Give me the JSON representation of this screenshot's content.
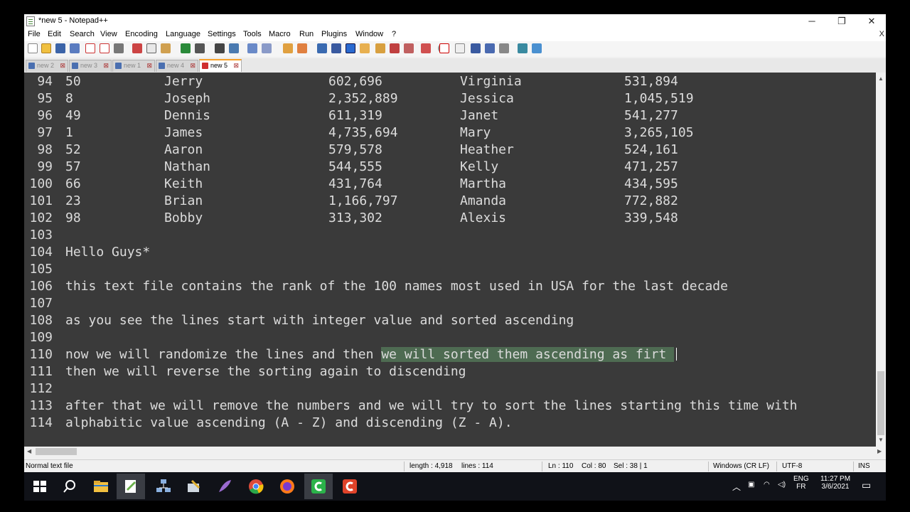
{
  "window": {
    "title": "*new 5 - Notepad++",
    "minimize": "─",
    "maximize": "❐",
    "close": "✕"
  },
  "menu": [
    "File",
    "Edit",
    "Search",
    "View",
    "Encoding",
    "Language",
    "Settings",
    "Tools",
    "Macro",
    "Run",
    "Plugins",
    "Window",
    "?"
  ],
  "menu_close": "X",
  "tabs": [
    {
      "label": "new 2",
      "active": false
    },
    {
      "label": "new 3",
      "active": false
    },
    {
      "label": "new 1",
      "active": false
    },
    {
      "label": "new 4",
      "active": false
    },
    {
      "label": "new 5",
      "active": true
    }
  ],
  "table_lines": [
    {
      "n": "94",
      "rank": "50",
      "male": "Jerry",
      "mcount": "602,696",
      "female": "Virginia",
      "fcount": "531,894"
    },
    {
      "n": "95",
      "rank": "8",
      "male": "Joseph",
      "mcount": "2,352,889",
      "female": "Jessica",
      "fcount": "1,045,519"
    },
    {
      "n": "96",
      "rank": "49",
      "male": "Dennis",
      "mcount": "611,319",
      "female": "Janet",
      "fcount": "541,277"
    },
    {
      "n": "97",
      "rank": "1",
      "male": "James",
      "mcount": "4,735,694",
      "female": "Mary",
      "fcount": "3,265,105"
    },
    {
      "n": "98",
      "rank": "52",
      "male": "Aaron",
      "mcount": "579,578",
      "female": "Heather",
      "fcount": "524,161"
    },
    {
      "n": "99",
      "rank": "57",
      "male": "Nathan",
      "mcount": "544,555",
      "female": "Kelly",
      "fcount": "471,257"
    },
    {
      "n": "100",
      "rank": "66",
      "male": "Keith",
      "mcount": "431,764",
      "female": "Martha",
      "fcount": "434,595"
    },
    {
      "n": "101",
      "rank": "23",
      "male": "Brian",
      "mcount": "1,166,797",
      "female": "Amanda",
      "fcount": "772,882"
    },
    {
      "n": "102",
      "rank": "98",
      "male": "Bobby",
      "mcount": "313,302",
      "female": "Alexis",
      "fcount": "339,548"
    }
  ],
  "text_lines": [
    {
      "n": "103",
      "text": ""
    },
    {
      "n": "104",
      "text": "Hello Guys*"
    },
    {
      "n": "105",
      "text": ""
    },
    {
      "n": "106",
      "text": "this text file contains the rank of the 100 names most used in USA for the last decade"
    },
    {
      "n": "107",
      "text": ""
    },
    {
      "n": "108",
      "text": "as you see the lines start with integer value and sorted ascending"
    },
    {
      "n": "109",
      "text": ""
    },
    {
      "n": "110",
      "text": "now we will randomize the lines and then ",
      "selected": "we will sorted them ascending as firt "
    },
    {
      "n": "111",
      "text": "then we will reverse the sorting again to discending"
    },
    {
      "n": "112",
      "text": ""
    },
    {
      "n": "113",
      "text": "after that we will remove the numbers and we will try to sort the lines starting this time with"
    },
    {
      "n": "114",
      "text": "alphabitic value ascending (A - Z) and discending (Z - A)."
    }
  ],
  "status": {
    "type": "Normal text file",
    "length": "length : 4,918",
    "lines": "lines : 114",
    "ln": "Ln : 110",
    "col": "Col : 80",
    "sel": "Sel : 38 | 1",
    "eol": "Windows (CR LF)",
    "encoding": "UTF-8",
    "mode": "INS"
  },
  "taskbar": {
    "lang_top": "ENG",
    "lang_bottom": "FR",
    "time": "11:27 PM",
    "date": "3/6/2021"
  },
  "colors": {
    "editor_bg": "#3a3a3a",
    "selection": "#4e6b52",
    "active_tab_accent": "#f7a12a"
  }
}
